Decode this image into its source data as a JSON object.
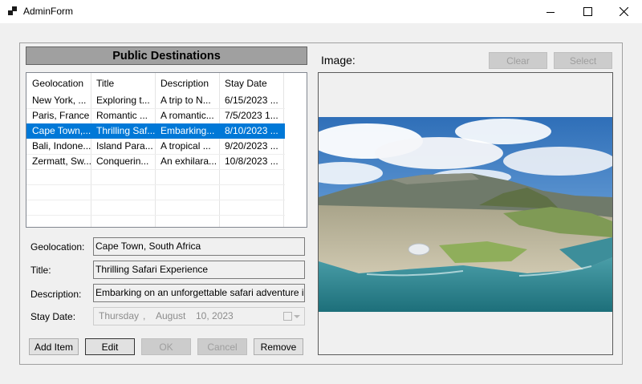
{
  "window": {
    "title": "AdminForm",
    "controls": [
      "minimize-icon",
      "maximize-icon",
      "close-icon"
    ]
  },
  "header": {
    "title": "Public Destinations"
  },
  "grid": {
    "columns": [
      "Geolocation",
      "Title",
      "Description",
      "Stay Date"
    ],
    "rows": [
      [
        "New York, ...",
        "Exploring t...",
        "A trip to N...",
        "6/15/2023 ..."
      ],
      [
        "Paris, France",
        "Romantic ...",
        "A romantic...",
        "7/5/2023 1..."
      ],
      [
        "Cape Town,...",
        "Thrilling Saf...",
        "Embarking...",
        "8/10/2023 ..."
      ],
      [
        "Bali, Indone...",
        "Island Para...",
        "A tropical ...",
        "9/20/2023 ..."
      ],
      [
        "Zermatt, Sw...",
        "Conquerin...",
        "An exhilara...",
        "10/8/2023 ..."
      ]
    ],
    "selected_row": 2
  },
  "form": {
    "geolocation_label": "Geolocation:",
    "geolocation_value": "Cape Town, South Africa",
    "title_label": "Title:",
    "title_value": "Thrilling Safari Experience",
    "description_label": "Description:",
    "description_value": "Embarking on an unforgettable safari adventure i",
    "staydate_label": "Stay Date:",
    "staydate_weekday": "Thursday",
    "staydate_sep": ",",
    "staydate_month": "August",
    "staydate_day_year": "10, 2023"
  },
  "buttons": {
    "add": "Add Item",
    "edit": "Edit",
    "ok": "OK",
    "cancel": "Cancel",
    "remove": "Remove",
    "clear": "Clear",
    "select": "Select"
  },
  "image_panel": {
    "label": "Image:"
  },
  "colors": {
    "selection": "#0078d7",
    "header_bar": "#a0a0a0",
    "window_bg": "#f0f0f0"
  }
}
